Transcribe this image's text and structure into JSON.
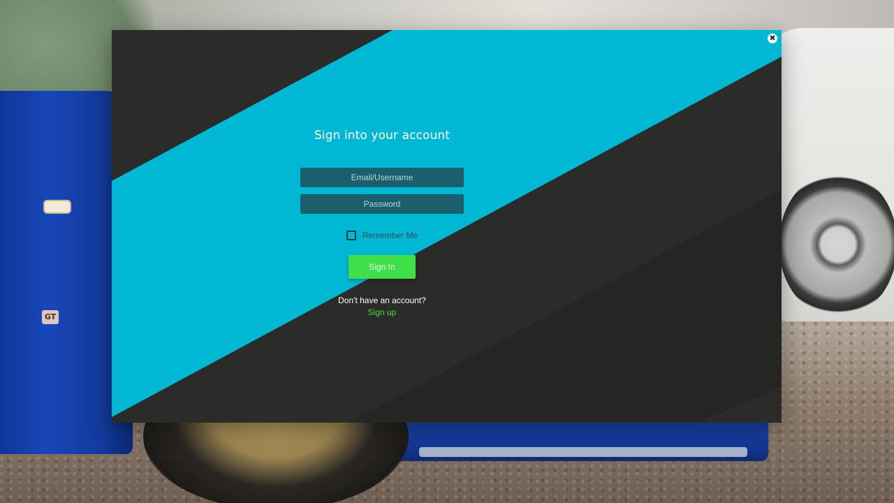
{
  "dialog": {
    "title": "Sign into your account",
    "close_glyph": "✖",
    "close_icon": "close-icon"
  },
  "form": {
    "email_placeholder": "Email/Username",
    "password_placeholder": "Password",
    "remember_label": "Remember Me",
    "signin_label": "Sign In",
    "no_account_text": "Don't have an account?",
    "signup_label": "Sign up"
  },
  "colors": {
    "accent_cyan": "#00b8d4",
    "panel_dark": "#2b2b2a",
    "button_green": "#3fe04a",
    "input_teal": "#1c5f6c"
  },
  "background": {
    "emblem_text": "GT"
  }
}
